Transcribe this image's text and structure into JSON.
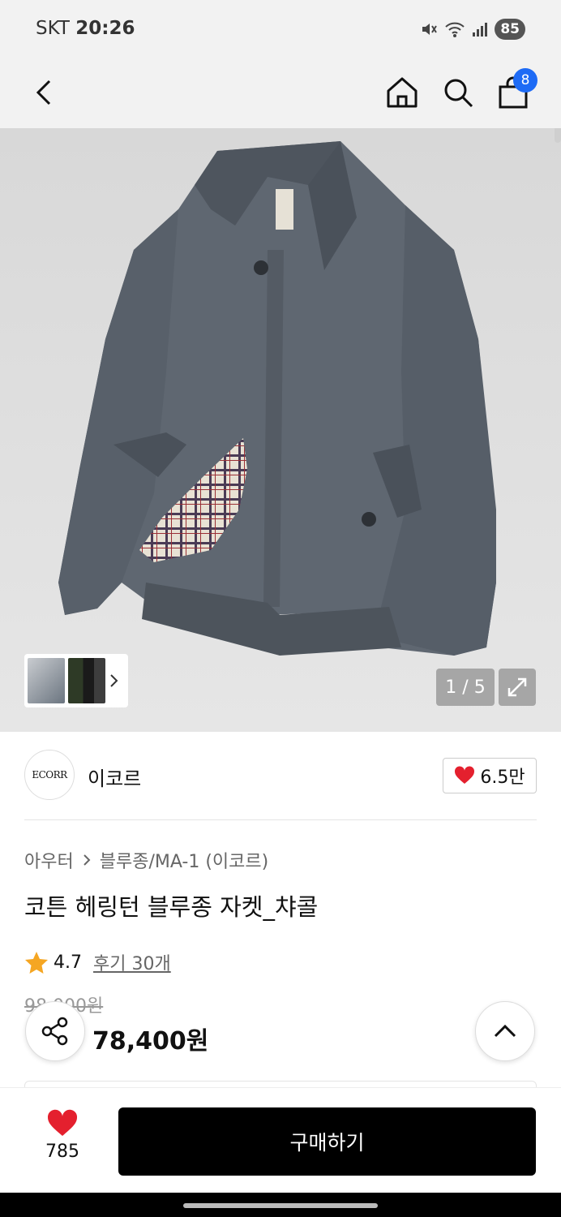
{
  "status_bar": {
    "carrier": "SKT",
    "time": "20:26",
    "battery": "85"
  },
  "header": {
    "cart_count": "8"
  },
  "gallery": {
    "counter": "1 / 5"
  },
  "brand": {
    "logo_text": "ECORR",
    "name": "이코르",
    "likes": "6.5만",
    "accent_color": "#e4202e"
  },
  "breadcrumb": {
    "category": "아우터",
    "subcategory": "블루종/MA-1 (이코르)"
  },
  "product": {
    "title": "코튼 헤링턴 블루종 자켓_챠콜",
    "rating": "4.7",
    "reviews": "후기 30개",
    "original_price": "98,000원",
    "sale_price": "78,400원"
  },
  "bottom": {
    "wish_count": "785",
    "buy_label": "구매하기"
  }
}
